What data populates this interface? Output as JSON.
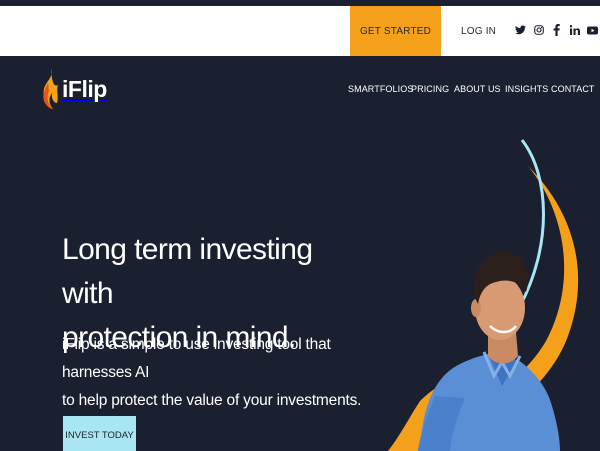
{
  "topbar": {
    "get_started_label": "GET STARTED",
    "login_label": "LOG IN",
    "social_icons": [
      "twitter-icon",
      "instagram-icon",
      "facebook-icon",
      "linkedin-icon",
      "youtube-icon"
    ]
  },
  "brand": {
    "name": "iFlip",
    "flame_colors": [
      "#f5a01a",
      "#e2541b"
    ]
  },
  "nav": {
    "items": [
      "SMARTFOLIOS",
      "PRICING",
      "ABOUT US",
      "INSIGHTS",
      "CONTACT"
    ]
  },
  "hero": {
    "headline_line1": "Long term investing with",
    "headline_line2": "protection in mind.",
    "subtext_line1": "iFlip is a simple to use investing tool that harnesses AI",
    "subtext_line2": "to help protect the value of your investments.",
    "cta_label": "INVEST TODAY"
  },
  "colors": {
    "background": "#1b2030",
    "accent_orange": "#f5a01a",
    "accent_cyan": "#a9e6f2",
    "topbar": "#ffffff"
  }
}
